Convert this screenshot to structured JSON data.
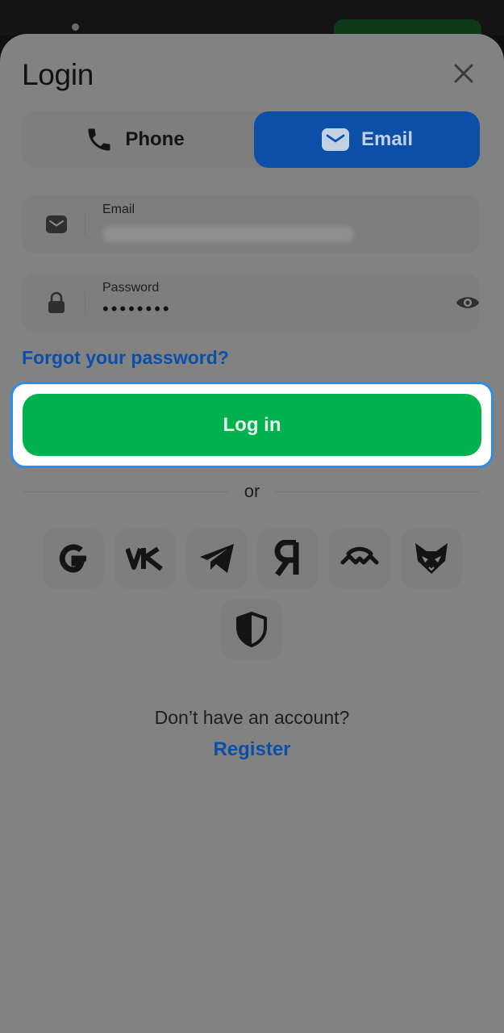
{
  "header": {
    "title": "Login"
  },
  "tabs": [
    {
      "label": "Phone",
      "icon": "phone-icon",
      "active": false
    },
    {
      "label": "Email",
      "icon": "envelope-icon",
      "active": true
    }
  ],
  "email_field": {
    "label": "Email",
    "icon": "envelope-icon",
    "value_obscured": true
  },
  "password_field": {
    "label": "Password",
    "icon": "lock-icon",
    "value": "••••••••",
    "toggle_icon": "eye-icon"
  },
  "forgot_link": "Forgot your password?",
  "login_button": "Log in",
  "divider_text": "or",
  "social_providers": [
    {
      "name": "Google",
      "icon": "google-icon",
      "glyph": "G"
    },
    {
      "name": "VK",
      "icon": "vk-icon",
      "glyph": "VK"
    },
    {
      "name": "Telegram",
      "icon": "telegram-icon"
    },
    {
      "name": "Yandex",
      "icon": "yandex-icon",
      "glyph": "Я"
    },
    {
      "name": "WalletConnect",
      "icon": "walletconnect-icon"
    },
    {
      "name": "MetaMask",
      "icon": "fox-icon"
    },
    {
      "name": "Shield",
      "icon": "shield-icon"
    }
  ],
  "footer": {
    "prompt": "Don’t have an account?",
    "register_link": "Register"
  },
  "colors": {
    "accent_blue": "#0c4fa8",
    "login_green": "#00b24e",
    "focus_ring": "#2b8cf2",
    "overlay_sheet": "#828282"
  }
}
